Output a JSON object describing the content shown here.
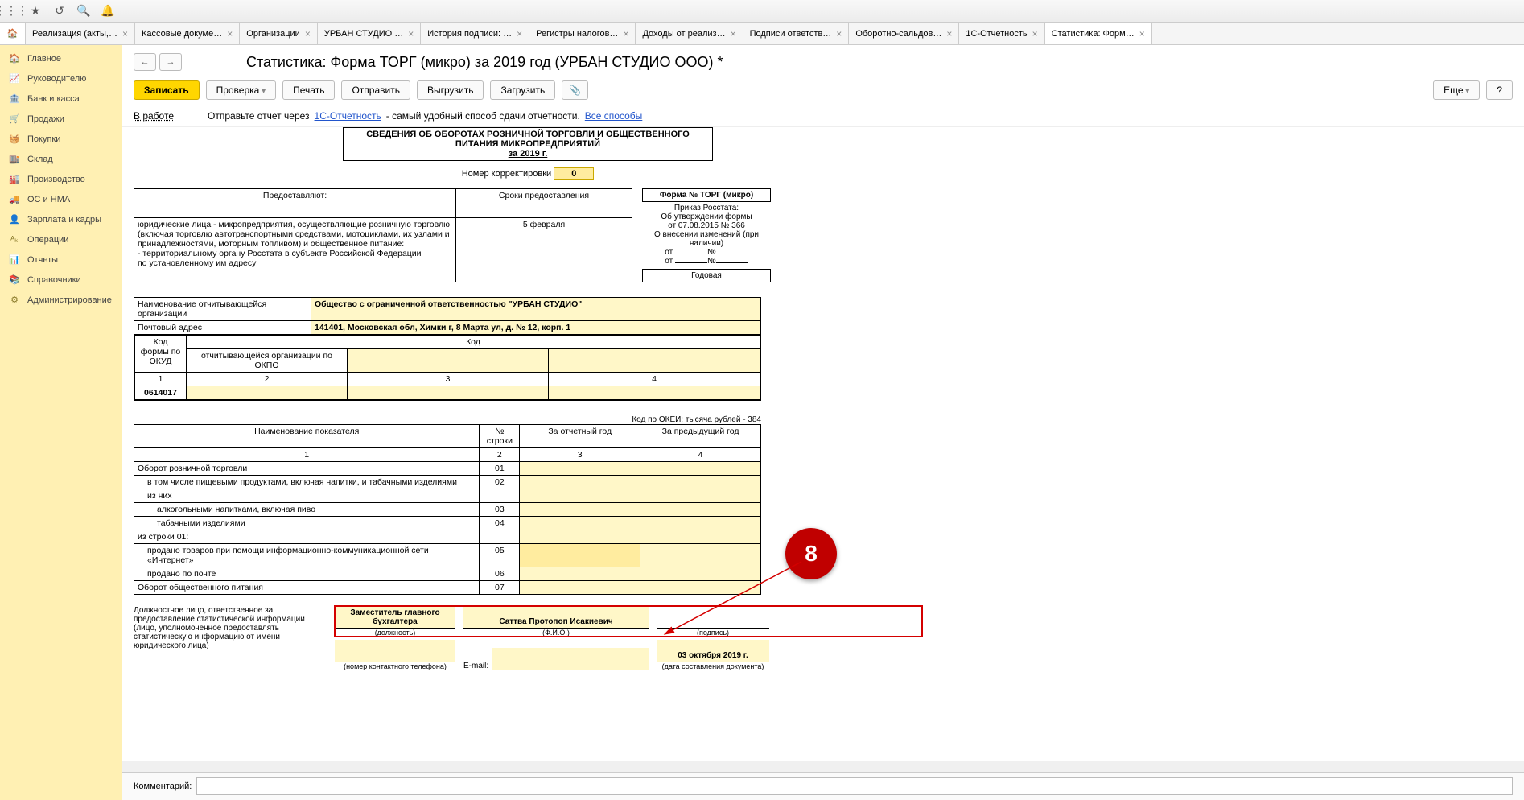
{
  "tabs": [
    "Реализация (акты,…",
    "Кассовые докуме…",
    "Организации",
    "УРБАН СТУДИО …",
    "История подписи: …",
    "Регистры налогов…",
    "Доходы от реализ…",
    "Подписи ответств…",
    "Оборотно-сальдов…",
    "1С-Отчетность",
    "Статистика: Форм…"
  ],
  "active_tab_index": 10,
  "sidebar": [
    {
      "icon": "🏠",
      "label": "Главное"
    },
    {
      "icon": "📈",
      "label": "Руководителю"
    },
    {
      "icon": "🏦",
      "label": "Банк и касса"
    },
    {
      "icon": "🛒",
      "label": "Продажи"
    },
    {
      "icon": "🧺",
      "label": "Покупки"
    },
    {
      "icon": "🏬",
      "label": "Склад"
    },
    {
      "icon": "🏭",
      "label": "Производство"
    },
    {
      "icon": "🚚",
      "label": "ОС и НМА"
    },
    {
      "icon": "👤",
      "label": "Зарплата и кадры"
    },
    {
      "icon": "ᴬₖ",
      "label": "Операции"
    },
    {
      "icon": "📊",
      "label": "Отчеты"
    },
    {
      "icon": "📚",
      "label": "Справочники"
    },
    {
      "icon": "⚙",
      "label": "Администрирование"
    }
  ],
  "page_title": "Статистика: Форма ТОРГ (микро) за 2019 год (УРБАН СТУДИО ООО) *",
  "buttons": {
    "write": "Записать",
    "check": "Проверка",
    "print": "Печать",
    "send": "Отправить",
    "export": "Выгрузить",
    "import": "Загрузить",
    "more": "Еще",
    "help": "?"
  },
  "info": {
    "status": "В работе",
    "send_hint": "Отправьте отчет через",
    "link1": "1С-Отчетность",
    "send_tail": " - самый удобный способ сдачи отчетности.",
    "link2": "Все способы"
  },
  "form": {
    "header": "СВЕДЕНИЯ ОБ ОБОРОТАХ РОЗНИЧНОЙ ТОРГОВЛИ И ОБЩЕСТВЕННОГО ПИТАНИЯ МИКРОПРЕДПРИЯТИЙ",
    "header_year": "за 2019 г.",
    "corr_label": "Номер корректировки",
    "corr_value": "0",
    "provide_hdr": "Предоставляют:",
    "deadline_hdr": "Сроки предоставления",
    "deadline_val": "5 февраля",
    "provide_body": "юридические лица - микропредприятия, осуществляющие розничную торговлю (включая торговлю автотранспортными средствами, мотоциклами, их узлами и принадлежностями, моторным топливом) и общественное питание:\n   - территориальному органу Росстата в субъекте Российской Федерации\n   по установленному им адресу",
    "right": {
      "formno": "Форма № ТОРГ (микро)",
      "l1": "Приказ Росстата:",
      "l2": "Об утверждении формы",
      "l3": "от 07.08.2015 № 366",
      "l4": "О внесении изменений (при наличии)",
      "l5a": "от",
      "l5b": "№",
      "l6a": "от",
      "l6b": "№",
      "annual": "Годовая"
    },
    "org_row_lbl": "Наименование отчитывающейся организации",
    "org_row_val": "Общество с ограниченной ответственностью \"УРБАН СТУДИО\"",
    "addr_row_lbl": "Почтовый адрес",
    "addr_row_val": "141401, Московская обл, Химки г, 8 Марта ул, д. № 12, корп. 1",
    "code_hdr": "Код",
    "okud_lbl": "Код формы по ОКУД",
    "okpo_lbl": "отчитывающейся организации по ОКПО",
    "okud_val": "0614017",
    "okei": "Код по ОКЕИ: тысяча рублей - 384",
    "thead": {
      "c1": "Наименование показателя",
      "c2": "№ строки",
      "c3": "За отчетный год",
      "c4": "За предыдущий год"
    },
    "thead2": {
      "c1": "1",
      "c2": "2",
      "c3": "3",
      "c4": "4"
    },
    "rows": [
      {
        "name": "Оборот розничной торговли",
        "no": "01",
        "pad": 0
      },
      {
        "name": "в том числе пищевыми продуктами, включая напитки, и табачными изделиями",
        "no": "02",
        "pad": 1
      },
      {
        "name": "из них",
        "no": "",
        "pad": 1
      },
      {
        "name": "алкогольными напитками, включая пиво",
        "no": "03",
        "pad": 2
      },
      {
        "name": "табачными изделиями",
        "no": "04",
        "pad": 2
      },
      {
        "name": "из строки 01:",
        "no": "",
        "pad": 0
      },
      {
        "name": "продано товаров при помощи информационно-коммуникационной сети «Интернет»",
        "no": "05",
        "pad": 1
      },
      {
        "name": "продано по почте",
        "no": "06",
        "pad": 1
      },
      {
        "name": "Оборот общественного питания",
        "no": "07",
        "pad": 0
      }
    ],
    "sig": {
      "left": "Должностное лицо, ответственное за предоставление статистической информации (лицо, уполномоченное предоставлять статистическую информацию от имени юридического лица)",
      "position": "Заместитель главного бухгалтера",
      "fio": "Саттва Протопоп Исакиевич",
      "date": "03 октября 2019 г.",
      "cap_pos": "(должность)",
      "cap_fio": "(Ф.И.О.)",
      "cap_sign": "(подпись)",
      "cap_phone": "(номер контактного телефона)",
      "email_lbl": "E-mail:",
      "cap_date": "(дата составления документа)"
    },
    "badge": "8"
  },
  "comment_label": "Комментарий:"
}
